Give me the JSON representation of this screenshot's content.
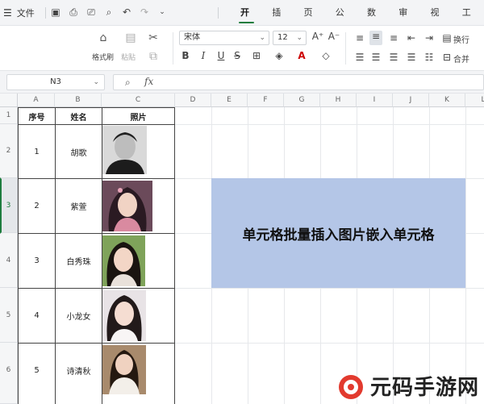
{
  "menubar": {
    "menu_label": "文件",
    "tabs": [
      "开始",
      "插入",
      "页面",
      "公式",
      "数据",
      "审阅",
      "视图",
      "工具"
    ],
    "active_tab": "开始"
  },
  "ribbon": {
    "format_painter": "格式刷",
    "paste": "粘贴",
    "font_name": "宋体",
    "font_size": "12",
    "wrap_text": "换行",
    "merge": "合并"
  },
  "formula_bar": {
    "name_box": "N3",
    "fx_label": "fx",
    "formula": ""
  },
  "sheet": {
    "columns": [
      "A",
      "B",
      "C",
      "D",
      "E",
      "F",
      "G",
      "H",
      "I",
      "J",
      "K",
      "L"
    ],
    "rows": [
      "1",
      "2",
      "3",
      "4",
      "5",
      "6"
    ],
    "headers": [
      "序号",
      "姓名",
      "照片"
    ],
    "records": [
      {
        "id": "1",
        "name": "胡歌"
      },
      {
        "id": "2",
        "name": "紫萱"
      },
      {
        "id": "3",
        "name": "白秀珠"
      },
      {
        "id": "4",
        "name": "小龙女"
      },
      {
        "id": "5",
        "name": "诗清秋"
      }
    ],
    "banner_text": "单元格批量插入图片嵌入单元格"
  },
  "watermark": "元码手游网"
}
